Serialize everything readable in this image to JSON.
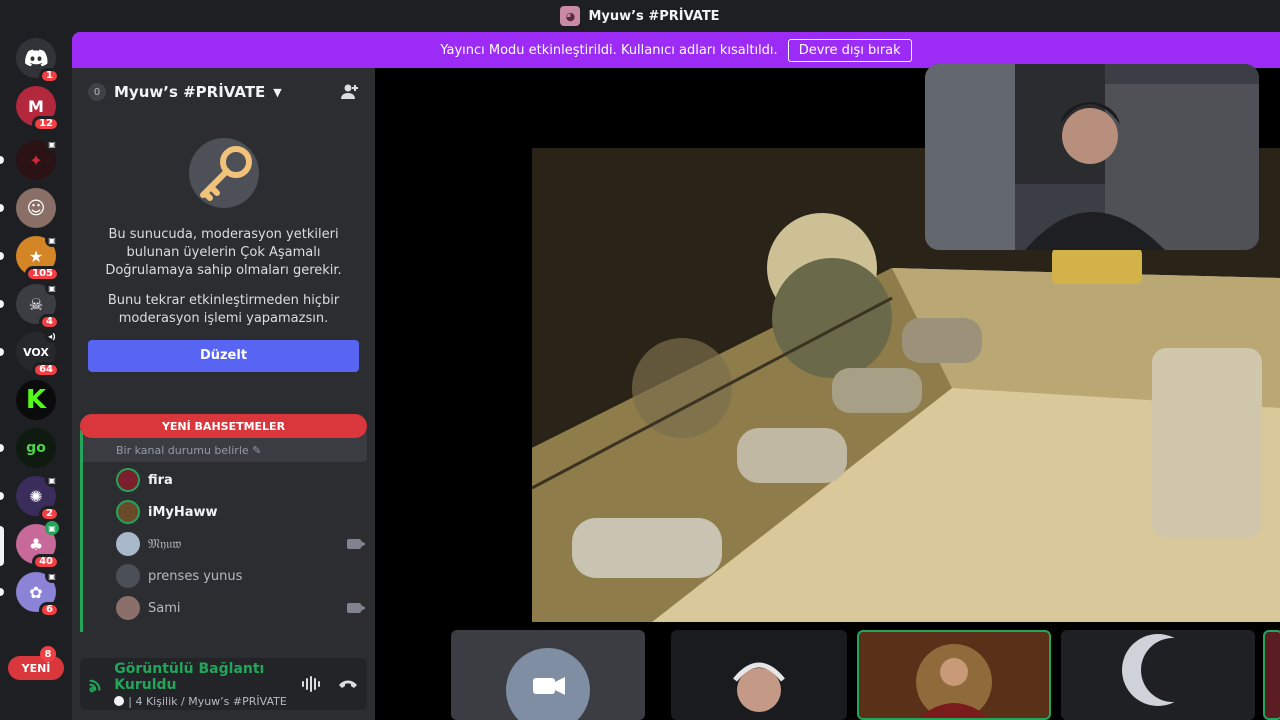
{
  "window": {
    "title": "Myuw’s #PRİVATE"
  },
  "banner": {
    "text": "Yayıncı Modu etkinleştirildi. Kullanıcı adları kısaltıldı.",
    "button": "Devre dışı bırak"
  },
  "rail": {
    "servers": [
      {
        "name": "discord-home-icon",
        "badge": "1"
      },
      {
        "name": "server-red-m",
        "badge": "12"
      },
      {
        "name": "server-dragon",
        "badge": ""
      },
      {
        "name": "server-girl",
        "badge": ""
      },
      {
        "name": "server-yellow",
        "badge": "105"
      },
      {
        "name": "server-mask",
        "badge": "4"
      },
      {
        "name": "server-vox",
        "badge": "64"
      },
      {
        "name": "server-kick",
        "badge": ""
      },
      {
        "name": "server-go",
        "badge": ""
      },
      {
        "name": "server-purple-fighter",
        "badge": "2"
      },
      {
        "name": "server-pink-creature",
        "badge": "40"
      },
      {
        "name": "server-anime",
        "badge": "6"
      }
    ],
    "new_pill": "YENİ",
    "last_badge": "8"
  },
  "sidebar": {
    "guild_name": "Myuw’s #PRİVATE",
    "boost_level": "0",
    "mfa_text_1": "Bu sunucuda, moderasyon yetkileri bulunan üyelerin Çok Aşamalı Doğrulamaya sahip olmaları gerekir.",
    "mfa_text_2": "Bunu tekrar etkinleştirmeden hiçbir moderasyon işlemi yapamazsın.",
    "mfa_button": "Düzelt",
    "mentions_bar": "YENİ BAHSETMELER",
    "channel_status": "Bir kanal durumu belirle",
    "voice_users": [
      {
        "name": "fira",
        "active": true,
        "camera": false,
        "color": "#7a1f2b"
      },
      {
        "name": "iMyHaww",
        "active": true,
        "camera": false,
        "color": "#6b4a2a"
      },
      {
        "name": "𝔐𝔶𝔲𝔴",
        "active": false,
        "camera": true,
        "color": "#a8b7c9"
      },
      {
        "name": "prenses yunus",
        "active": false,
        "camera": false,
        "color": "#4a4e56"
      },
      {
        "name": "Sami",
        "active": false,
        "camera": true,
        "color": "#8a6f6a"
      }
    ],
    "connection": {
      "title": "Görüntülü Bağlantı Kuruldu",
      "subtitle": "| 4 Kişilik / Myuw’s #PRİVATE"
    }
  }
}
